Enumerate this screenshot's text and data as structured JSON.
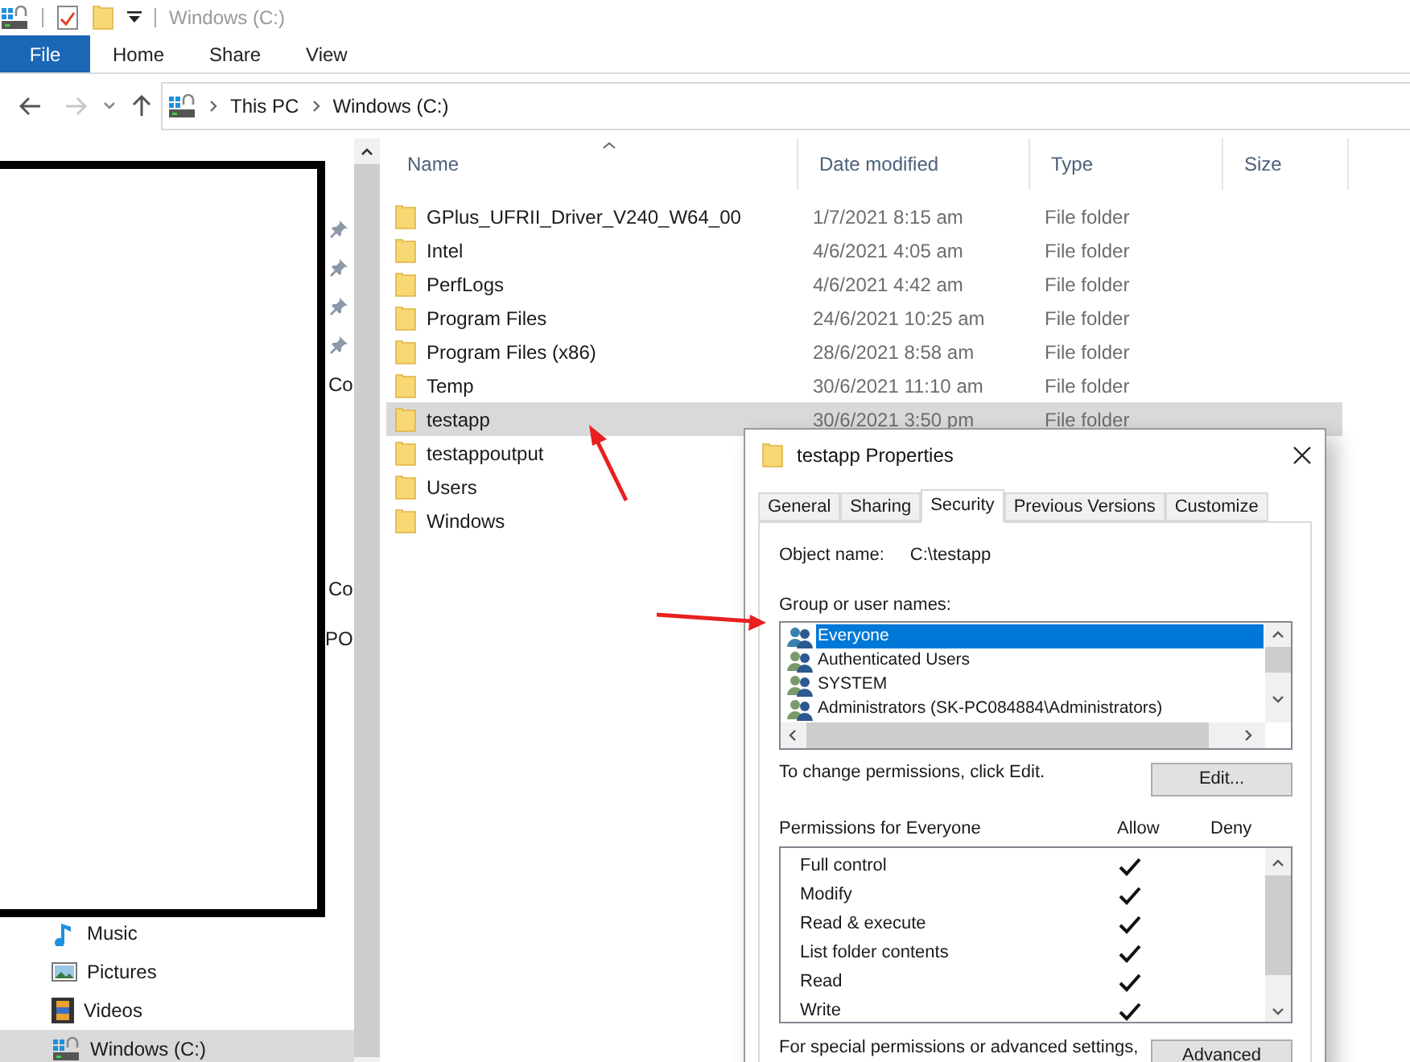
{
  "window": {
    "title": "Windows (C:)"
  },
  "ribbon_tabs": [
    {
      "label": "File",
      "selected": true
    },
    {
      "label": "Home",
      "selected": false
    },
    {
      "label": "Share",
      "selected": false
    },
    {
      "label": "View",
      "selected": false
    }
  ],
  "breadcrumb": [
    "This PC",
    "Windows (C:)"
  ],
  "nav_fragments": [
    "Co",
    "Co",
    "PO"
  ],
  "nav_items": [
    {
      "label": "Music",
      "kind": "music",
      "selected": false
    },
    {
      "label": "Pictures",
      "kind": "pictures",
      "selected": false
    },
    {
      "label": "Videos",
      "kind": "videos",
      "selected": false
    },
    {
      "label": "Windows (C:)",
      "kind": "drive",
      "selected": true
    }
  ],
  "table": {
    "columns": [
      "Name",
      "Date modified",
      "Type",
      "Size"
    ],
    "rows": [
      {
        "name": "GPlus_UFRII_Driver_V240_W64_00",
        "date": "1/7/2021 8:15 am",
        "type": "File folder",
        "selected": false
      },
      {
        "name": "Intel",
        "date": "4/6/2021 4:05 am",
        "type": "File folder",
        "selected": false
      },
      {
        "name": "PerfLogs",
        "date": "4/6/2021 4:42 am",
        "type": "File folder",
        "selected": false
      },
      {
        "name": "Program Files",
        "date": "24/6/2021 10:25 am",
        "type": "File folder",
        "selected": false
      },
      {
        "name": "Program Files (x86)",
        "date": "28/6/2021 8:58 am",
        "type": "File folder",
        "selected": false
      },
      {
        "name": "Temp",
        "date": "30/6/2021 11:10 am",
        "type": "File folder",
        "selected": false
      },
      {
        "name": "testapp",
        "date": "30/6/2021 3:50 pm",
        "type": "File folder",
        "selected": true
      },
      {
        "name": "testappoutput",
        "selected": false
      },
      {
        "name": "Users",
        "selected": false
      },
      {
        "name": "Windows",
        "selected": false
      }
    ]
  },
  "dialog": {
    "title": "testapp Properties",
    "tabs": [
      {
        "label": "General",
        "selected": false
      },
      {
        "label": "Sharing",
        "selected": false
      },
      {
        "label": "Security",
        "selected": true
      },
      {
        "label": "Previous Versions",
        "selected": false
      },
      {
        "label": "Customize",
        "selected": false
      }
    ],
    "object_name_label": "Object name:",
    "object_name": "C:\\testapp",
    "group_label": "Group or user names:",
    "users": [
      {
        "name": "Everyone",
        "selected": true
      },
      {
        "name": "Authenticated Users",
        "selected": false
      },
      {
        "name": "SYSTEM",
        "selected": false
      },
      {
        "name": "Administrators (SK-PC084884\\Administrators)",
        "selected": false
      }
    ],
    "edit_hint": "To change permissions, click Edit.",
    "edit_button": "Edit...",
    "permissions_label": "Permissions for Everyone",
    "allow_label": "Allow",
    "deny_label": "Deny",
    "permissions": [
      {
        "name": "Full control",
        "allow": true,
        "deny": false
      },
      {
        "name": "Modify",
        "allow": true,
        "deny": false
      },
      {
        "name": "Read & execute",
        "allow": true,
        "deny": false
      },
      {
        "name": "List folder contents",
        "allow": true,
        "deny": false
      },
      {
        "name": "Read",
        "allow": true,
        "deny": false
      },
      {
        "name": "Write",
        "allow": true,
        "deny": false
      }
    ],
    "advanced_hint": "For special permissions or advanced settings,",
    "advanced_button": "Advanced"
  }
}
